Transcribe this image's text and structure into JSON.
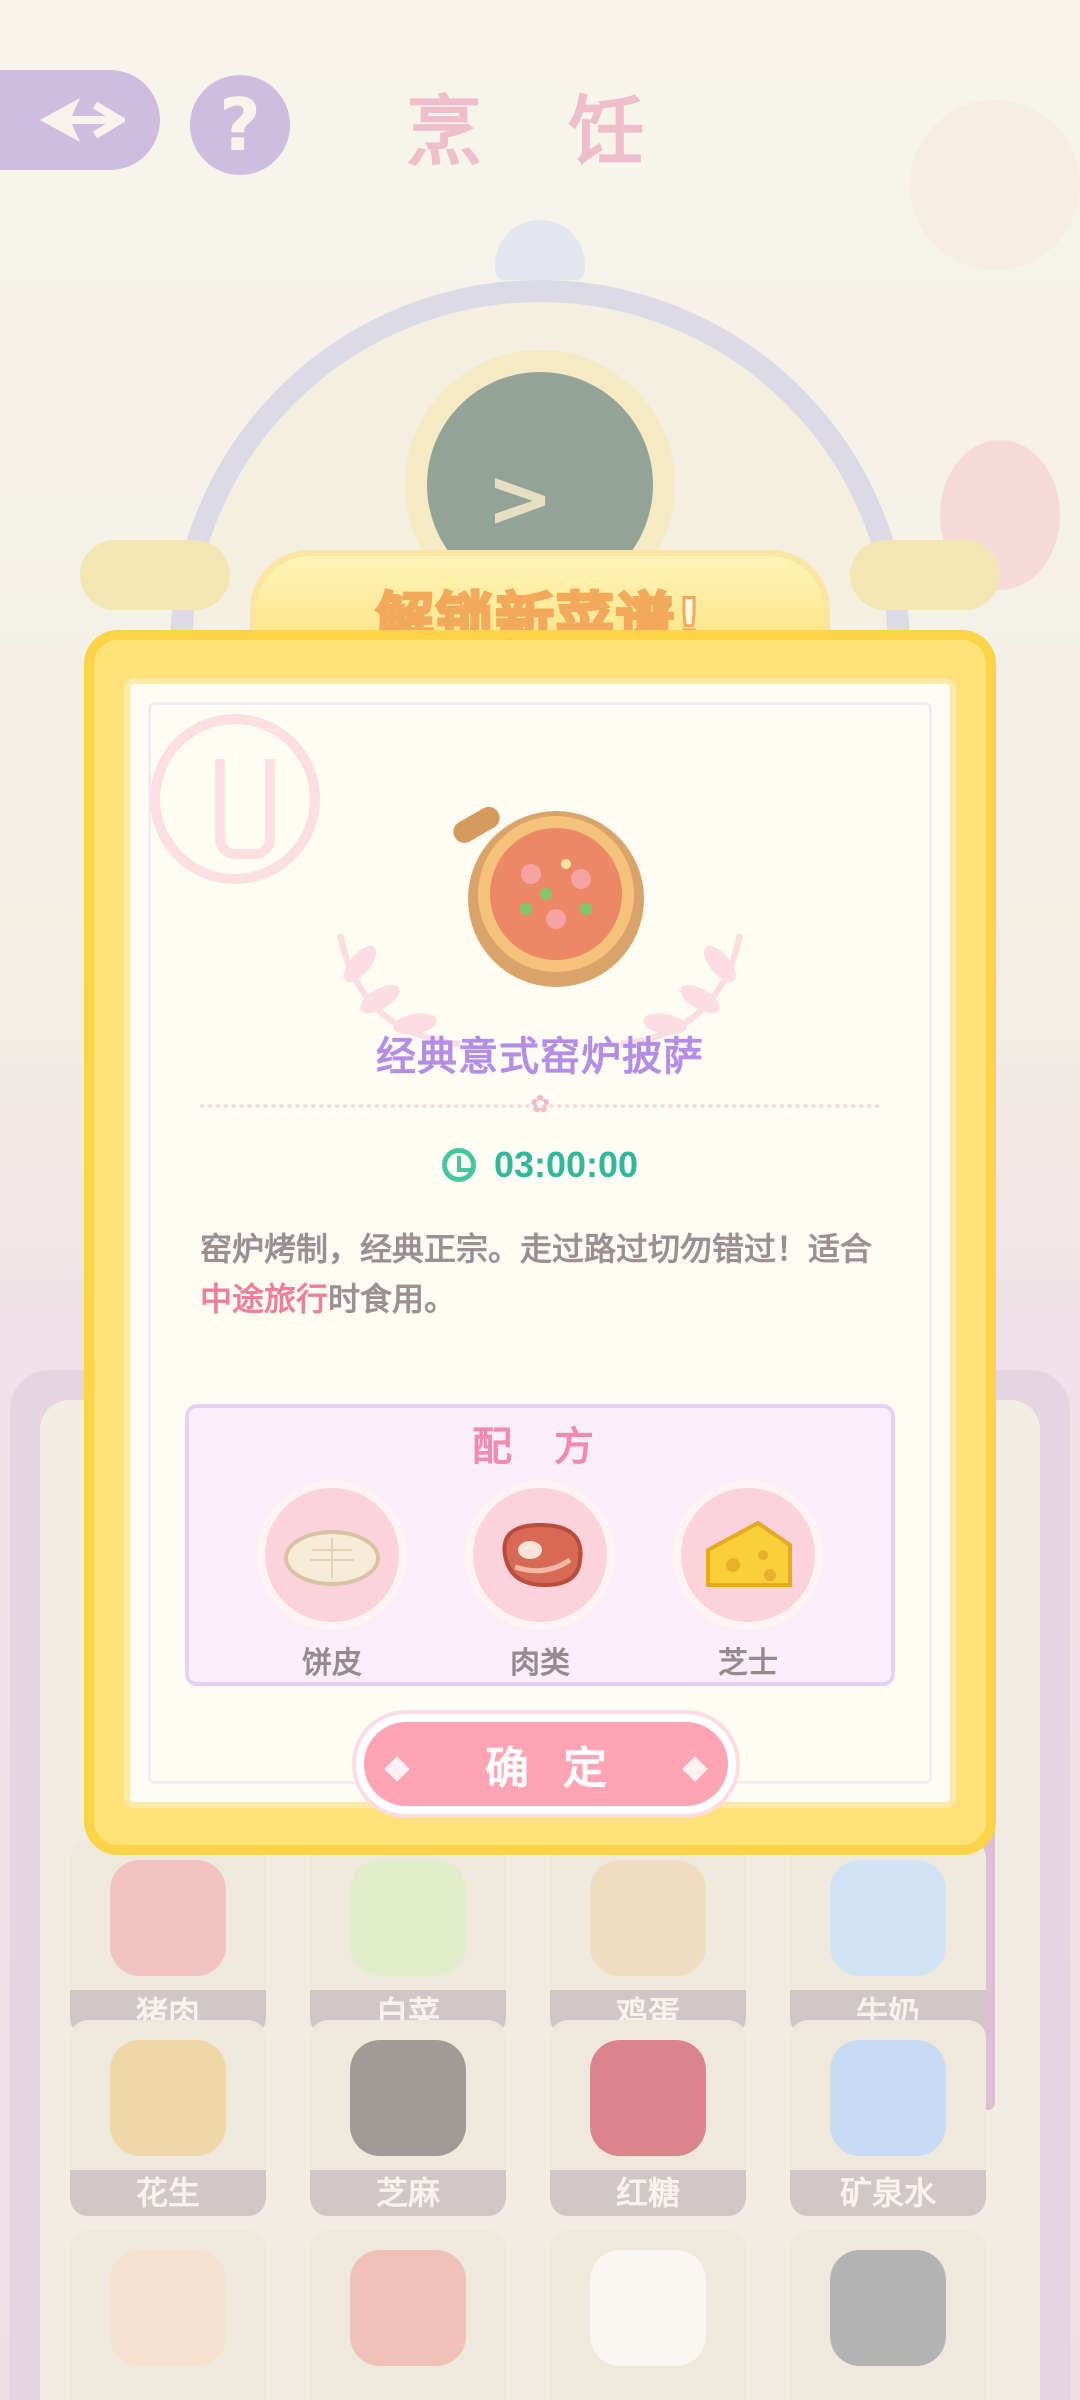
{
  "page": {
    "title": "烹 饪"
  },
  "robot": {
    "face": "> <"
  },
  "pantry": {
    "items": [
      {
        "label": "猪肉",
        "color": "#e8a2a2"
      },
      {
        "label": "白菜",
        "color": "#cfe3b0"
      },
      {
        "label": "鸡蛋",
        "color": "#e8c99c"
      },
      {
        "label": "牛奶",
        "color": "#b9d4ef"
      },
      {
        "label": "花生",
        "color": "#e7c279"
      },
      {
        "label": "芝麻",
        "color": "#6f6460"
      },
      {
        "label": "红糖",
        "color": "#c9434f"
      },
      {
        "label": "矿泉水",
        "color": "#a9c8ee"
      }
    ]
  },
  "modal": {
    "banner": "解锁新菜谱!",
    "dish_name": "经典意式窑炉披萨",
    "timer": "03:00:00",
    "description": {
      "before": "窑炉烤制，经典正宗。走过路过切勿错过！适合",
      "highlight": "中途旅行",
      "after": "时食用。"
    },
    "recipe_title": "配 方",
    "ingredients": [
      {
        "label": "饼皮",
        "icon": "crust-icon"
      },
      {
        "label": "肉类",
        "icon": "meat-icon"
      },
      {
        "label": "芝士",
        "icon": "cheese-icon"
      }
    ],
    "confirm": "确定"
  },
  "colors": {
    "accent_pink": "#ef7f99",
    "timer_green": "#2fb89a",
    "dish_purple": "#b38de6",
    "modal_yellow": "#fde27a"
  }
}
